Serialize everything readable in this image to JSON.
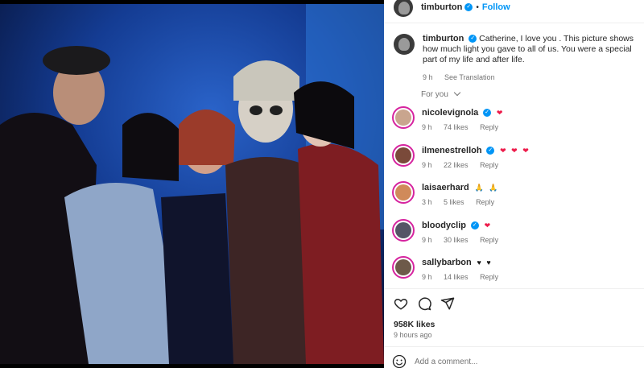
{
  "header": {
    "username": "timburton",
    "dot": "•",
    "follow_label": "Follow"
  },
  "caption": {
    "username": "timburton",
    "text": "Catherine, I love you . This picture shows how much light you gave to all of us. You were a special part of my life and after life.",
    "time": "9 h",
    "translation_label": "See Translation"
  },
  "sort": {
    "label": "For you"
  },
  "comments": [
    {
      "username": "nicolevignola",
      "emoji": "❤",
      "time": "9 h",
      "likes": "74 likes",
      "reply": "Reply",
      "verified": true,
      "avatar_color": "#c9a58e"
    },
    {
      "username": "ilmenestrelloh",
      "emoji": "❤ ❤ ❤",
      "time": "9 h",
      "likes": "22 likes",
      "reply": "Reply",
      "verified": true,
      "avatar_color": "#7a4a3a"
    },
    {
      "username": "laisaerhard",
      "emoji": "🙏 🙏",
      "time": "3 h",
      "likes": "5 likes",
      "reply": "Reply",
      "verified": false,
      "avatar_color": "#d08a5a"
    },
    {
      "username": "bloodyclip",
      "emoji": "❤",
      "time": "9 h",
      "likes": "30 likes",
      "reply": "Reply",
      "verified": true,
      "avatar_color": "#555566"
    },
    {
      "username": "sallybarbon",
      "emoji": "♥ ♥",
      "time": "9 h",
      "likes": "14 likes",
      "reply": "Reply",
      "verified": false,
      "avatar_color": "#6d5a4a"
    }
  ],
  "post": {
    "likes": "958K likes",
    "time_ago": "9 hours ago"
  },
  "add_comment": {
    "placeholder": "Add a comment..."
  },
  "icons": {
    "heart": "heart-icon",
    "comment": "comment-icon",
    "share": "share-icon",
    "emoji": "emoji-icon"
  },
  "colors": {
    "accent": "#0095f6",
    "heart": "#ed1b4a",
    "muted": "#737373"
  }
}
